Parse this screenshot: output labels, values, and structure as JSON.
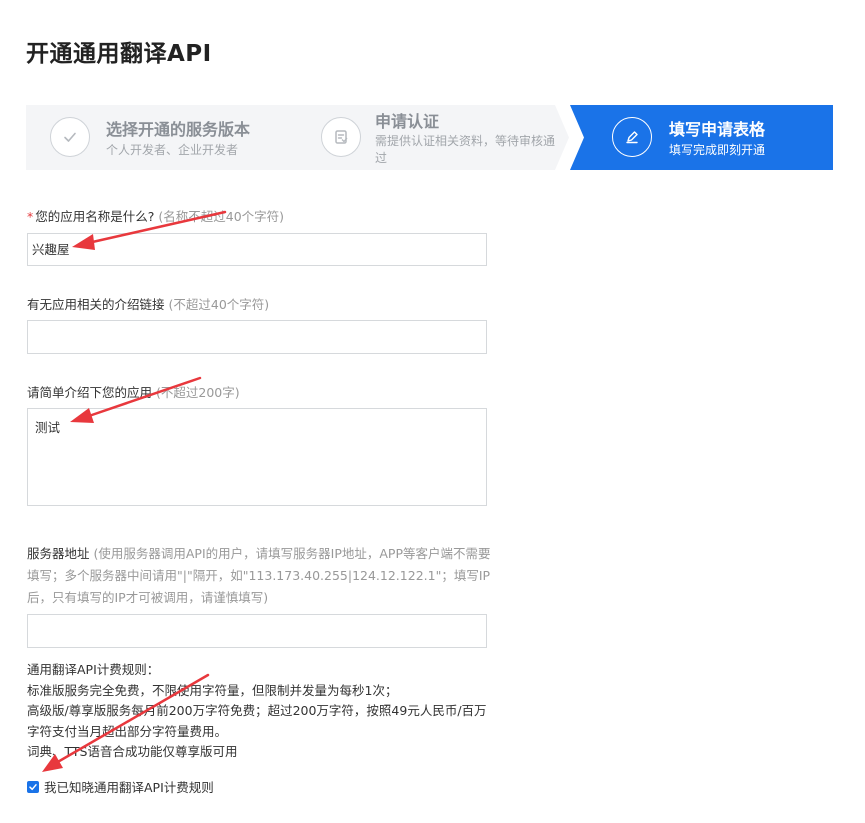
{
  "page": {
    "title": "开通通用翻译API"
  },
  "steps": [
    {
      "title": "选择开通的服务版本",
      "desc": "个人开发者、企业开发者",
      "icon": "check-icon",
      "active": false
    },
    {
      "title": "申请认证",
      "desc": "需提供认证相关资料，等待审核通过",
      "icon": "id-card-icon",
      "active": false
    },
    {
      "title": "填写申请表格",
      "desc": "填写完成即刻开通",
      "icon": "pencil-icon",
      "active": true
    }
  ],
  "form": {
    "app_name": {
      "required_mark": "*",
      "label": "您的应用名称是什么?",
      "hint": "(名称不超过40个字符)",
      "value": "兴趣屋"
    },
    "intro_link": {
      "label": "有无应用相关的介绍链接",
      "hint": "(不超过40个字符)",
      "value": ""
    },
    "app_intro": {
      "label": "请简单介绍下您的应用",
      "hint": "(不超过200字)",
      "value": "测试"
    },
    "server": {
      "label": "服务器地址",
      "hint": "(使用服务器调用API的用户，请填写服务器IP地址，APP等客户端不需要填写；多个服务器中间请用\"|\"隔开，如\"113.173.40.255|124.12.122.1\"；填写IP后，只有填写的IP才可被调用，请谨慎填写)",
      "value": ""
    }
  },
  "rules": {
    "title": "通用翻译API计费规则：",
    "lines": [
      "标准版服务完全免费，不限使用字符量，但限制并发量为每秒1次；",
      "高级版/尊享版服务每月前200万字符免费；超过200万字符，按照49元人民币/百万字符支付当月超出部分字符量费用。",
      "词典、TTS语音合成功能仅尊享版可用"
    ]
  },
  "agree": {
    "label": "我已知晓通用翻译API计费规则",
    "checked": true
  },
  "colors": {
    "accent": "#1a73e8",
    "required": "#e4393c",
    "annotation_arrow": "#e8383d"
  }
}
